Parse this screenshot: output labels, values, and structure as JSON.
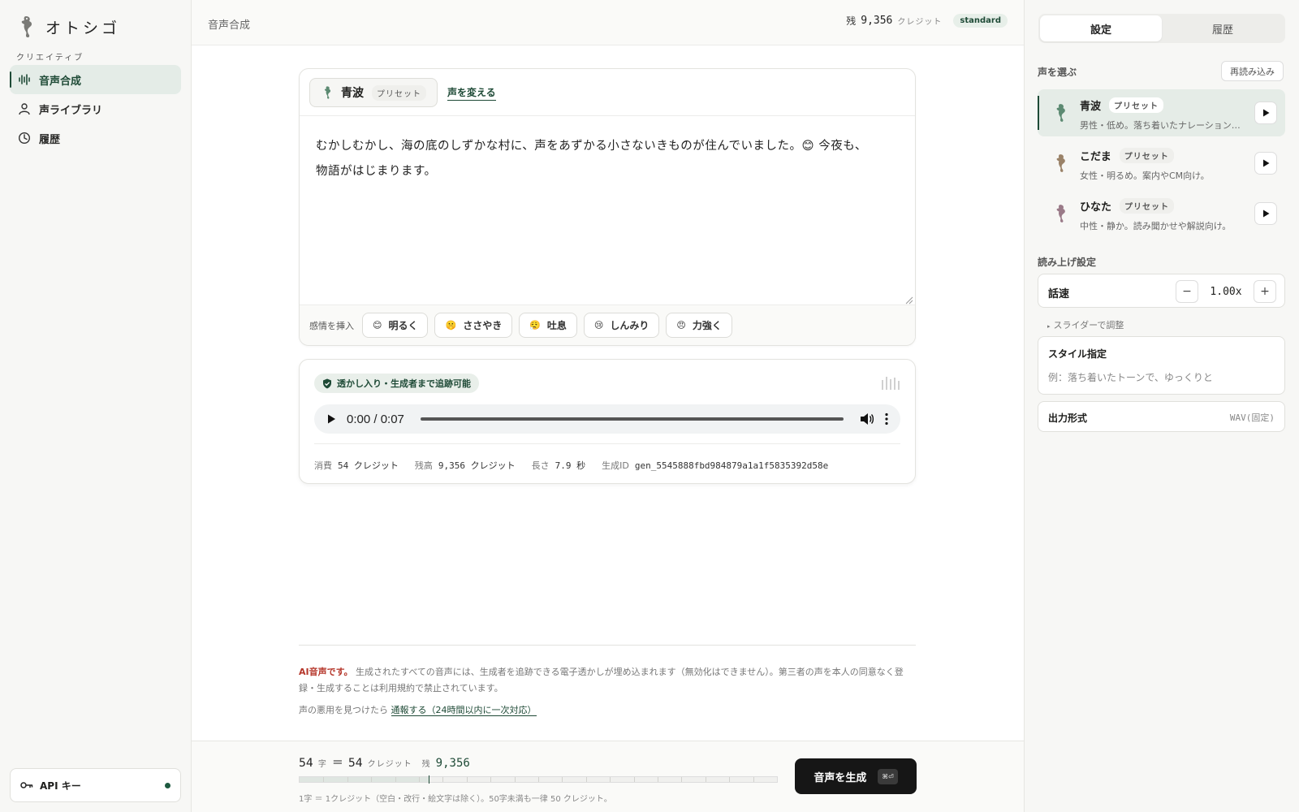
{
  "brand": {
    "name": "オトシゴ"
  },
  "sidebar": {
    "section": "クリエイティブ",
    "items": [
      {
        "label": "音声合成",
        "icon": "waveform-icon",
        "active": true
      },
      {
        "label": "声ライブラリ",
        "icon": "person-icon",
        "active": false
      },
      {
        "label": "履歴",
        "icon": "clock-icon",
        "active": false
      }
    ],
    "api_key_label": "API キー"
  },
  "topbar": {
    "breadcrumb": "音声合成",
    "credits_prefix": "残",
    "credits_value": "9,356",
    "credits_unit": "クレジット",
    "plan": "standard"
  },
  "editor": {
    "voice_name": "青波",
    "voice_tag": "プリセット",
    "change_voice": "声を変える",
    "text_line1": "むかしむかし、海の底のしずかな村に、声をあずかる小さないきものが住んでいました。😊 今夜も、",
    "text_line2": "物語がはじまります。",
    "emotion_label": "感情を挿入",
    "emotions": [
      {
        "emoji": "😊",
        "label": "明るく"
      },
      {
        "emoji": "🤫",
        "label": "ささやき"
      },
      {
        "emoji": "😮‍💨",
        "label": "吐息"
      },
      {
        "emoji": "😢",
        "label": "しんみり"
      },
      {
        "emoji": "😠",
        "label": "力強く"
      }
    ]
  },
  "audio": {
    "watermark": "透かし入り・生成者まで追跡可能",
    "time": "0:00 / 0:07",
    "meta": {
      "consumed_label": "消費",
      "consumed_value": "54 クレジット",
      "balance_label": "残高",
      "balance_value": "9,356 クレジット",
      "length_label": "長さ",
      "length_value": "7.9 秒",
      "id_label": "生成ID",
      "id_value": "gen_5545888fbd984879a1a1f5835392d58e"
    }
  },
  "notice": {
    "ai_label": "AI音声です。",
    "body": "生成されたすべての音声には、生成者を追跡できる電子透かしが埋め込まれます（無効化はできません）。第三者の声を本人の同意なく登録・生成することは利用規約で禁止されています。",
    "report_prefix": "声の悪用を見つけたら",
    "report_link": "通報する（24時間以内に一次対応）"
  },
  "bottom": {
    "chars": "54",
    "chars_unit": "字",
    "equals": "＝",
    "credits": "54",
    "credits_unit": "クレジット",
    "rest_prefix": "残",
    "rest_value": "9,356",
    "usage_fraction": 0.27,
    "rule": "1字 ＝ 1クレジット（空白・改行・絵文字は除く）。50字未満も一律 50 クレジット。",
    "generate": "音声を生成",
    "shortcut": "⌘⏎"
  },
  "rpanel": {
    "tabs": [
      "設定",
      "履歴"
    ],
    "voice_section": "声を選ぶ",
    "reload": "再読み込み",
    "voices": [
      {
        "name": "青波",
        "tag": "プリセット",
        "desc": "男性・低め。落ち着いたナレーション向け。",
        "color": "#5c8a72",
        "selected": true
      },
      {
        "name": "こだま",
        "tag": "プリセット",
        "desc": "女性・明るめ。案内やCM向け。",
        "color": "#9a8268",
        "selected": false
      },
      {
        "name": "ひなた",
        "tag": "プリセット",
        "desc": "中性・静か。読み聞かせや解説向け。",
        "color": "#9a7a88",
        "selected": false
      }
    ],
    "read_section": "読み上げ設定",
    "speed_label": "話速",
    "speed_value": "1.00x",
    "slider_hint": "スライダーで調整",
    "style_label": "スタイル指定",
    "style_placeholder": "例：落ち着いたトーンで、ゆっくりと",
    "format_label": "出力形式",
    "format_value": "WAV(固定)"
  }
}
